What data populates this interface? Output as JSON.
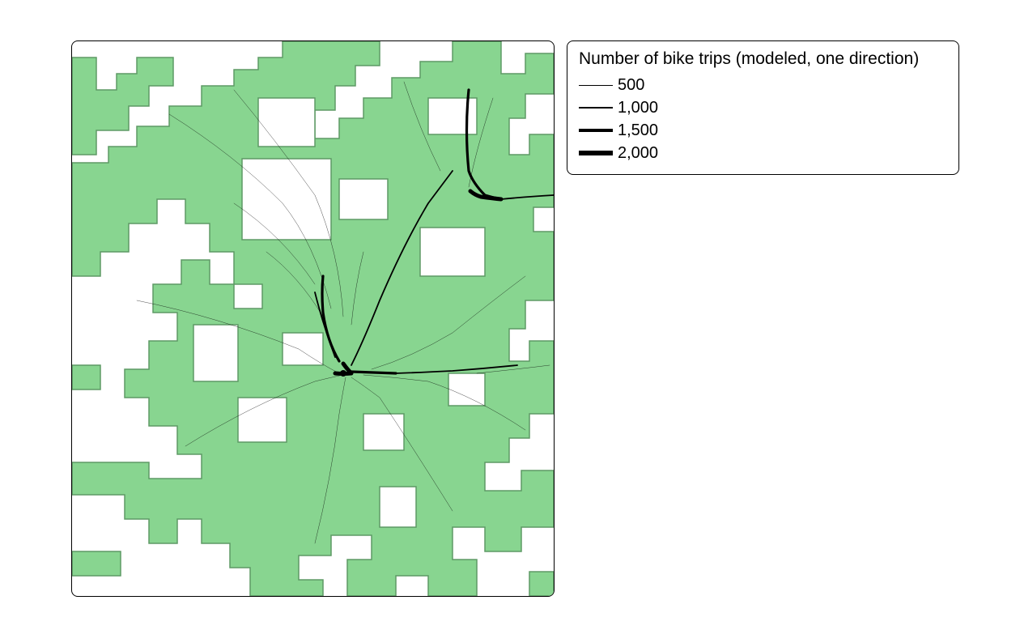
{
  "legend": {
    "title": "Number of bike trips (modeled, one direction)",
    "items": [
      {
        "label": "500",
        "thickness": 1
      },
      {
        "label": "1,000",
        "thickness": 2.2
      },
      {
        "label": "1,500",
        "thickness": 3.8
      },
      {
        "label": "2,000",
        "thickness": 5.5
      }
    ]
  },
  "map": {
    "region_fill": "#88d590",
    "region_stroke": "#5e9a65",
    "route_color": "#000000",
    "background": "#ffffff"
  }
}
